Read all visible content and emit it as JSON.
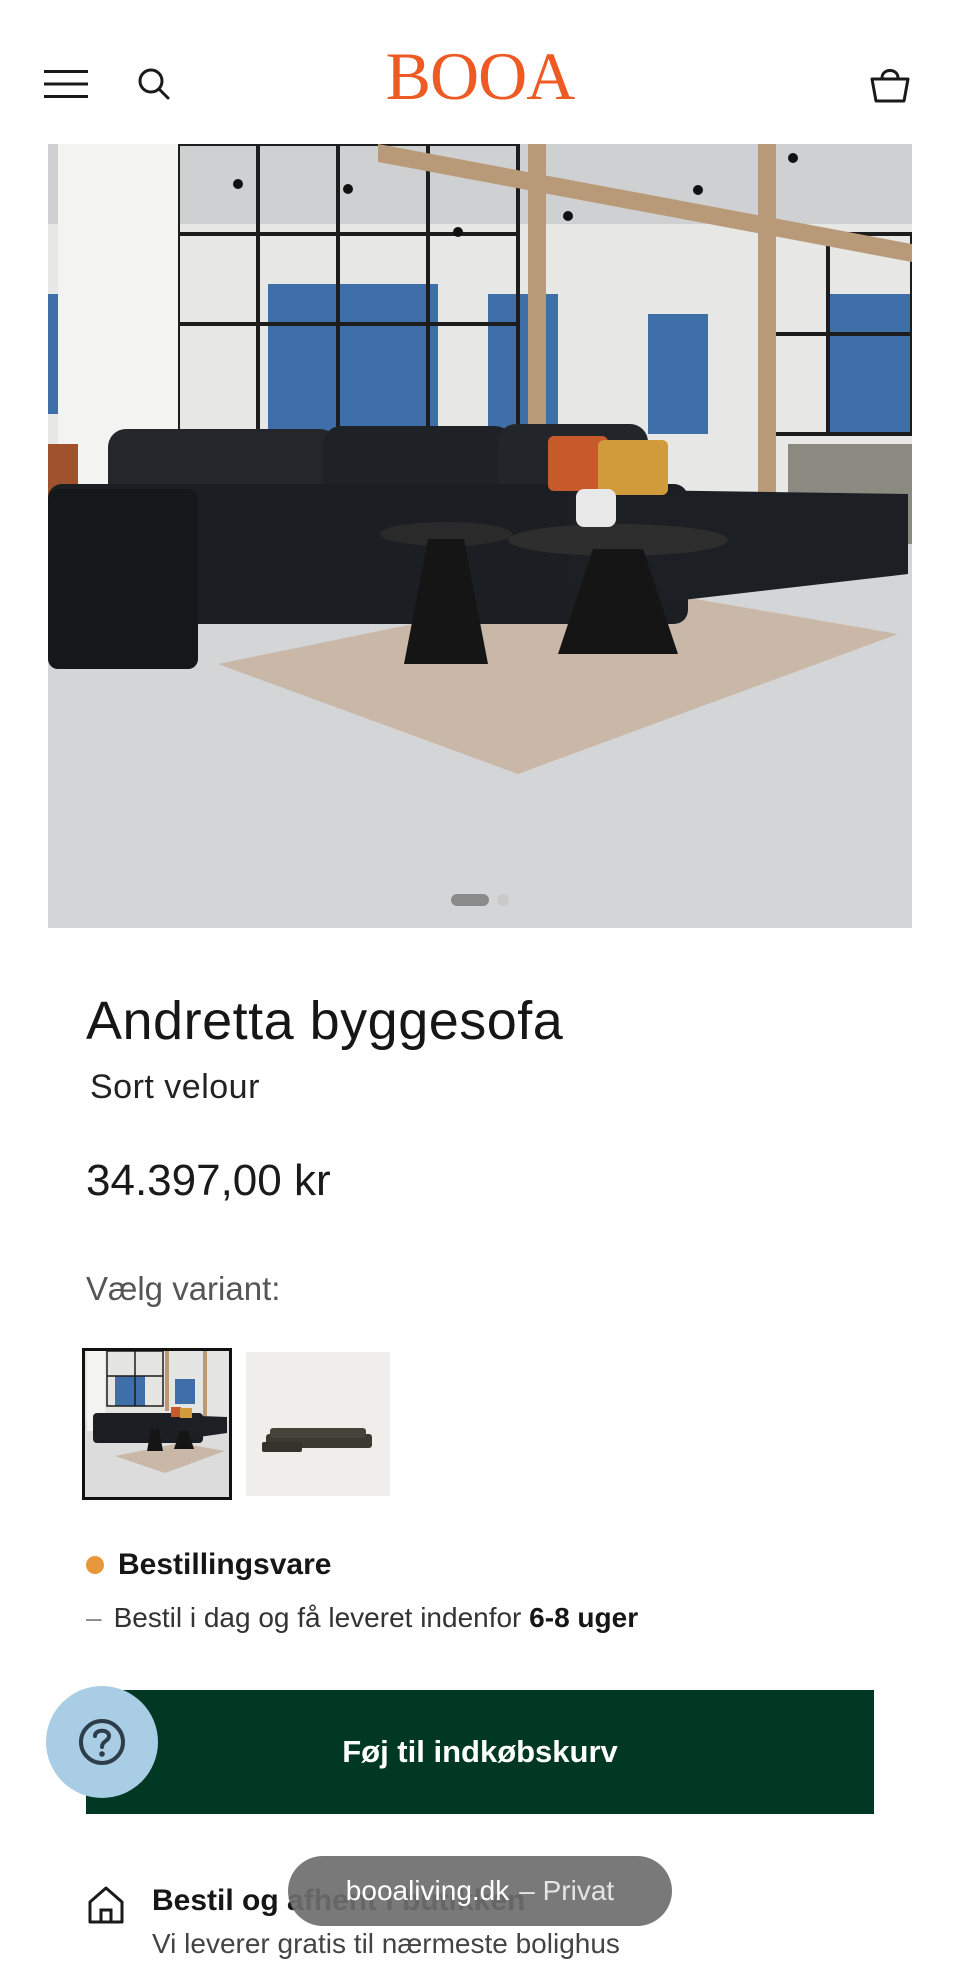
{
  "header": {
    "logo": "BOOA",
    "icons": [
      "menu-icon",
      "search-icon",
      "basket-icon"
    ]
  },
  "gallery": {
    "slide_count": 2,
    "active_index": 1
  },
  "product": {
    "title": "Andretta byggesofa",
    "subtitle": "Sort velour",
    "price": "34.397,00 kr",
    "variant_label": "Vælg variant:"
  },
  "stock": {
    "status": "Bestillingsvare",
    "status_color": "#e8983a",
    "delivery_prefix": "Bestil i dag og få leveret indenfor",
    "delivery_time": "6-8 uger"
  },
  "actions": {
    "add_to_cart": "Føj til indkøbskurv",
    "button_color": "#003824"
  },
  "info": {
    "title": "Bestil og afhent i butikken",
    "subtitle": "Vi leverer gratis til nærmeste bolighus"
  },
  "browser": {
    "domain": "booaliving.dk",
    "mode": "– Privat"
  },
  "colors": {
    "brand": "#ee5a24"
  }
}
